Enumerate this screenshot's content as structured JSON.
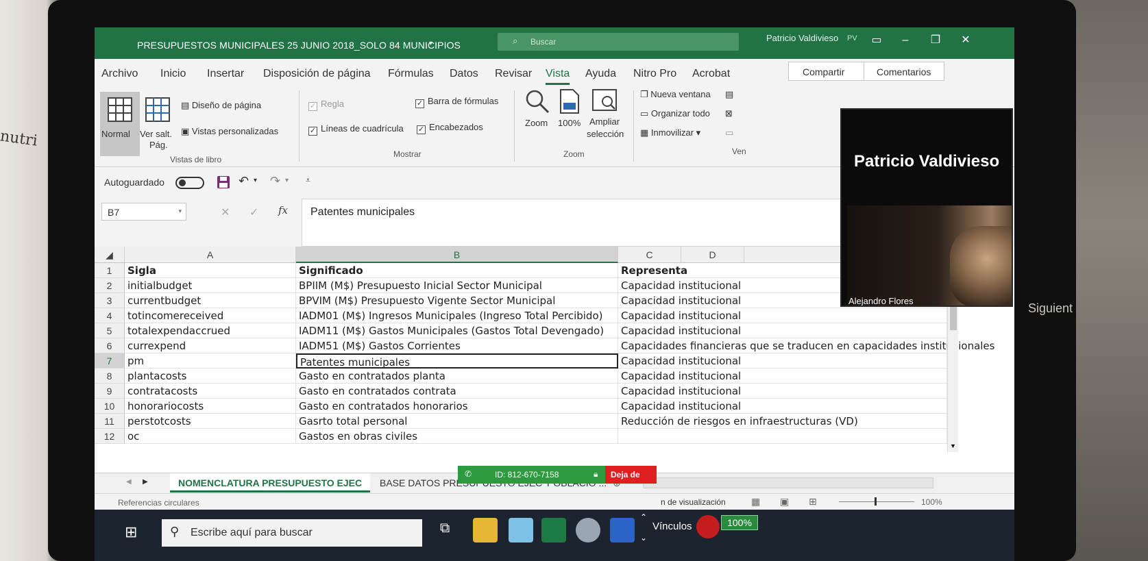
{
  "window": {
    "title": "PRESUPUESTOS MUNICIPALES 25 JUNIO 2018_SOLO 84 MUNICIPIOS",
    "search_placeholder": "Buscar",
    "user": "Patricio Valdivieso",
    "user_initials": "PV"
  },
  "menu": {
    "items": [
      "Archivo",
      "Inicio",
      "Insertar",
      "Disposición de página",
      "Fórmulas",
      "Datos",
      "Revisar",
      "Vista",
      "Ayuda",
      "Nitro Pro",
      "Acrobat"
    ],
    "active": "Vista",
    "share_label": "Compartir",
    "comments_label": "Comentarios"
  },
  "ribbon": {
    "normal_label": "Normal",
    "page_break_label_1": "Ver salt.",
    "page_break_label_2": "Pág.",
    "page_layout_label": "Diseño de página",
    "custom_views_label": "Vistas personalizadas",
    "group_views": "Vistas de libro",
    "ruler_label": "Regla",
    "formula_bar_label": "Barra de fórmulas",
    "gridlines_label": "Líneas de cuadrícula",
    "headings_label": "Encabezados",
    "group_show": "Mostrar",
    "zoom_label": "Zoom",
    "zoom100_label": "100%",
    "zoom_selection_1": "Ampliar",
    "zoom_selection_2": "selección",
    "group_zoom": "Zoom",
    "new_window_label": "Nueva ventana",
    "arrange_all_label": "Organizar todo",
    "freeze_label": "Inmovilizar",
    "group_window": "Ven"
  },
  "qat": {
    "autosave_label": "Autoguardado"
  },
  "formula_bar": {
    "name_box": "B7",
    "content": "Patentes municipales"
  },
  "grid": {
    "columns": [
      "A",
      "B",
      "C",
      "D"
    ],
    "rows": [
      {
        "n": "1",
        "a": "Sigla",
        "b": "Significado",
        "c": "Representa"
      },
      {
        "n": "2",
        "a": "initialbudget",
        "b": "BPIIM (M$) Presupuesto Inicial Sector Municipal",
        "c": "Capacidad institucional"
      },
      {
        "n": "3",
        "a": "currentbudget",
        "b": "BPVIM (M$) Presupuesto Vigente Sector Municipal",
        "c": "Capacidad institucional"
      },
      {
        "n": "4",
        "a": "totincomereceived",
        "b": "IADM01 (M$) Ingresos Municipales (Ingreso Total Percibido)",
        "c": "Capacidad institucional"
      },
      {
        "n": "5",
        "a": "totalexpendaccrued",
        "b": "IADM11 (M$) Gastos Municipales (Gastos Total Devengado)",
        "c": "Capacidad institucional"
      },
      {
        "n": "6",
        "a": "currexpend",
        "b": "IADM51 (M$) Gastos Corrientes",
        "c": "Capacidades financieras que se traducen en capacidades institucionales"
      },
      {
        "n": "7",
        "a": "pm",
        "b": "Patentes municipales",
        "c": "Capacidad institucional"
      },
      {
        "n": "8",
        "a": "plantacosts",
        "b": "Gasto en contratados planta",
        "c": "Capacidad institucional"
      },
      {
        "n": "9",
        "a": "contratacosts",
        "b": "Gasto en contratados contrata",
        "c": "Capacidad institucional"
      },
      {
        "n": "10",
        "a": "honorariocosts",
        "b": "Gasto en contratados honorarios",
        "c": "Capacidad institucional"
      },
      {
        "n": "11",
        "a": "perstotcosts",
        "b": "Gasrto total personal",
        "c": "Reducción de riesgos en infraestructuras (VD)"
      },
      {
        "n": "12",
        "a": "oc",
        "b": "Gastos en obras civiles",
        "c": ""
      }
    ]
  },
  "sheets": {
    "tabs": [
      "NOMENCLATURA PRESUPUESTO EJEC",
      "BASE DATOS PRESUPUESTO EJEC",
      "POBLACIO ..."
    ],
    "active": "NOMENCLATURA PRESUPUESTO EJEC"
  },
  "status": {
    "left": "Referencias circulares",
    "view_settings": "n de visualización",
    "zoom": "100%"
  },
  "teamviewer": {
    "id": "ID: 812-670-7158",
    "stop": "Deja de"
  },
  "taskbar": {
    "search": "Escribe aquí para buscar",
    "links": "Vínculos",
    "battery": "100%"
  },
  "video": {
    "presenter": "Patricio Valdivieso",
    "participant": "Alejandro Flores"
  },
  "background": {
    "side_text": "Siguient",
    "handwriting": "nutri"
  },
  "colors": {
    "excel_green": "#217346",
    "teamviewer_green": "#2d9a3e",
    "stop_red": "#e02020"
  }
}
